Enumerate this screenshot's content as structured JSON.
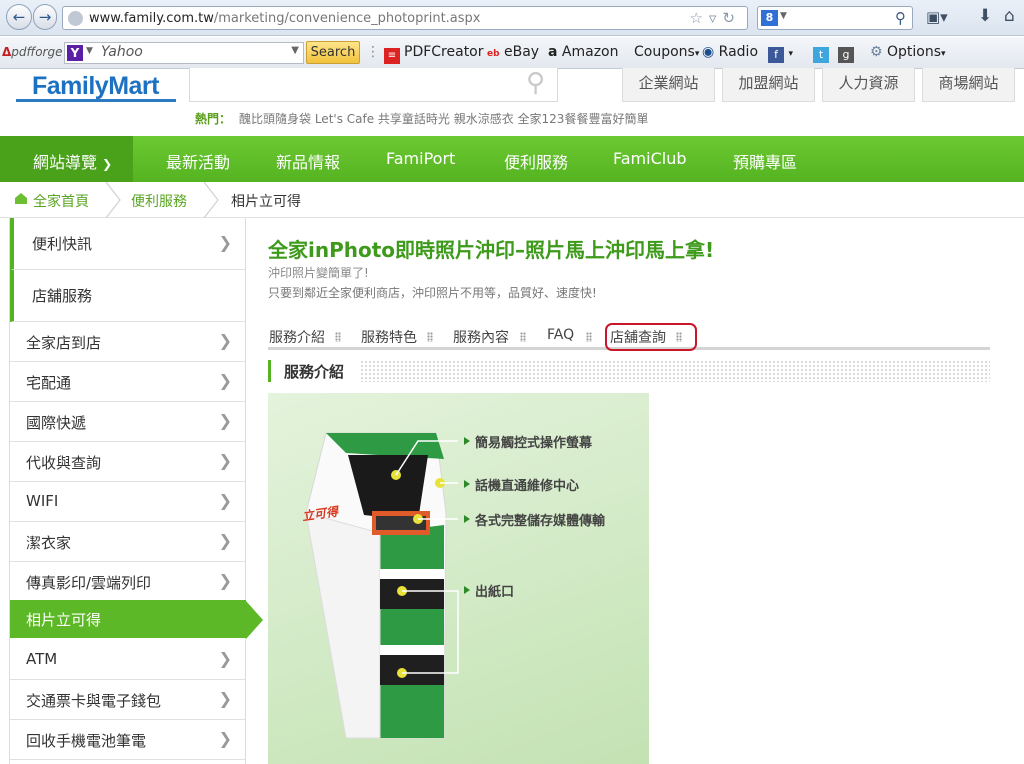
{
  "browser": {
    "url_host": "www.family.com.tw",
    "url_path": "/marketing/convenience_photoprint.aspx",
    "search_badge": "8",
    "bookmarks": {
      "pdfforge": "pdfforge",
      "yahoo_text": "Yahoo",
      "search_button": "Search",
      "pdfcreator": "PDFCreator",
      "ebay": "eBay",
      "amazon": "Amazon",
      "coupons": "Coupons",
      "radio": "Radio",
      "options": "Options"
    }
  },
  "site": {
    "logo": "FamilyMart",
    "top_links": [
      "企業網站",
      "加盟網站",
      "人力資源",
      "商場網站"
    ],
    "hot_label": "熱門：",
    "hot_text": "醜比頭隨身袋  Let's Cafe 共享童話時光  親水涼感衣  全家123餐餐豐富好簡單",
    "main_nav": [
      "網站導覽",
      "最新活動",
      "新品情報",
      "FamiPort",
      "便利服務",
      "FamiClub",
      "預購專區"
    ],
    "breadcrumb": [
      "全家首頁",
      "便利服務",
      "相片立可得"
    ]
  },
  "sidebar": {
    "items": [
      "便利快訊",
      "店舖服務",
      "全家店到店",
      "宅配通",
      "國際快遞",
      "代收與查詢",
      "WIFI",
      "潔衣家",
      "傳真影印/雲端列印",
      "相片立可得",
      "ATM",
      "交通票卡與電子錢包",
      "回收手機電池筆電"
    ],
    "active_index": 9
  },
  "main": {
    "title": "全家inPhoto即時照片沖印–照片馬上沖印馬上拿!",
    "subtitle1": "沖印照片變簡單了!",
    "subtitle2": "只要到鄰近全家便利商店，沖印照片不用等，品質好、速度快!",
    "tabs": [
      "服務介紹",
      "服務特色",
      "服務內容",
      "FAQ",
      "店舖查詢"
    ],
    "highlighted_tab_index": 4,
    "section_heading": "服務介紹",
    "machine_logo": "立可得",
    "callouts": [
      "簡易觸控式操作螢幕",
      "話機直通維修中心",
      "各式完整儲存媒體傳輸",
      "出紙口"
    ]
  },
  "colors": {
    "brand_green": "#55b321",
    "brand_blue": "#1d71c2",
    "highlight_red": "#c9162b"
  }
}
